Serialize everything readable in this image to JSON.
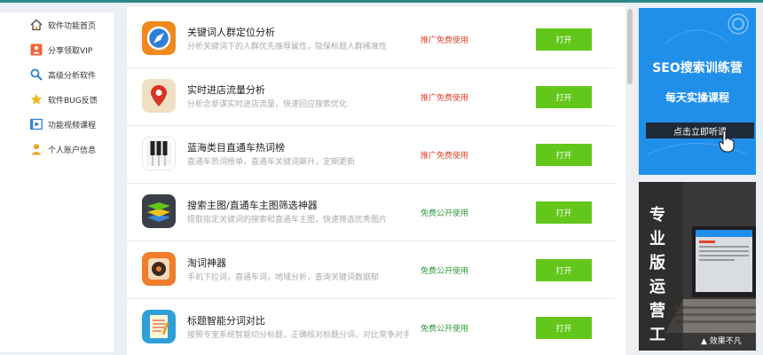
{
  "sidebar": {
    "items": [
      {
        "label": "软件功能首页",
        "icon": "home-icon"
      },
      {
        "label": "分享领取VIP",
        "icon": "share-user-icon"
      },
      {
        "label": "高级分析软件",
        "icon": "search-icon"
      },
      {
        "label": "软件BUG反馈",
        "icon": "star-icon"
      },
      {
        "label": "功能视频课程",
        "icon": "video-icon"
      },
      {
        "label": "个人账户信息",
        "icon": "user-icon"
      }
    ]
  },
  "tools": [
    {
      "title": "关键词人群定位分析",
      "desc": "分析关键词下的人群优先推荐属性，隐保标题人群稀准性",
      "status": "推广免费使用",
      "status_color": "#e8412b",
      "button": "打开",
      "icon": "compass-icon"
    },
    {
      "title": "实时进店流量分析",
      "desc": "分析念参谋实时进店流量，快速回应搜索优化",
      "status": "推广免费使用",
      "status_color": "#e8412b",
      "button": "打开",
      "icon": "location-pin-icon"
    },
    {
      "title": "蓝海类目直通车热词榜",
      "desc": "直通车热词榜单，直通车关键词飙升，定期更新",
      "status": "推广免费使用",
      "status_color": "#e8412b",
      "button": "打开",
      "icon": "piano-keys-icon"
    },
    {
      "title": "搜索主图/直通车主图筛选神器",
      "desc": "提取指定关键词的搜索和直通车主图，快速筛选优秀图片",
      "status": "免费公开使用",
      "status_color": "#2e9a3a",
      "button": "打开",
      "icon": "layers-icon"
    },
    {
      "title": "淘词神器",
      "desc": "手机下拉词，直通车词，地域分析，查询关键词数据郁",
      "status": "免费公开使用",
      "status_color": "#2e9a3a",
      "button": "打开",
      "icon": "record-icon"
    },
    {
      "title": "标题智能分词对比",
      "desc": "按照专宝系统智能切分标题，正确核对标题分词，对比竞争对手",
      "status": "免费公开使用",
      "status_color": "#2e9a3a",
      "button": "打开",
      "icon": "notepad-icon"
    }
  ],
  "ads": {
    "seo": {
      "title": "SEO搜索训练营",
      "subtitle": "每天实操课程",
      "cta": "点击立即听课"
    },
    "pro": {
      "vertical": "专业版运营工具",
      "footer": "效果不凡"
    }
  }
}
